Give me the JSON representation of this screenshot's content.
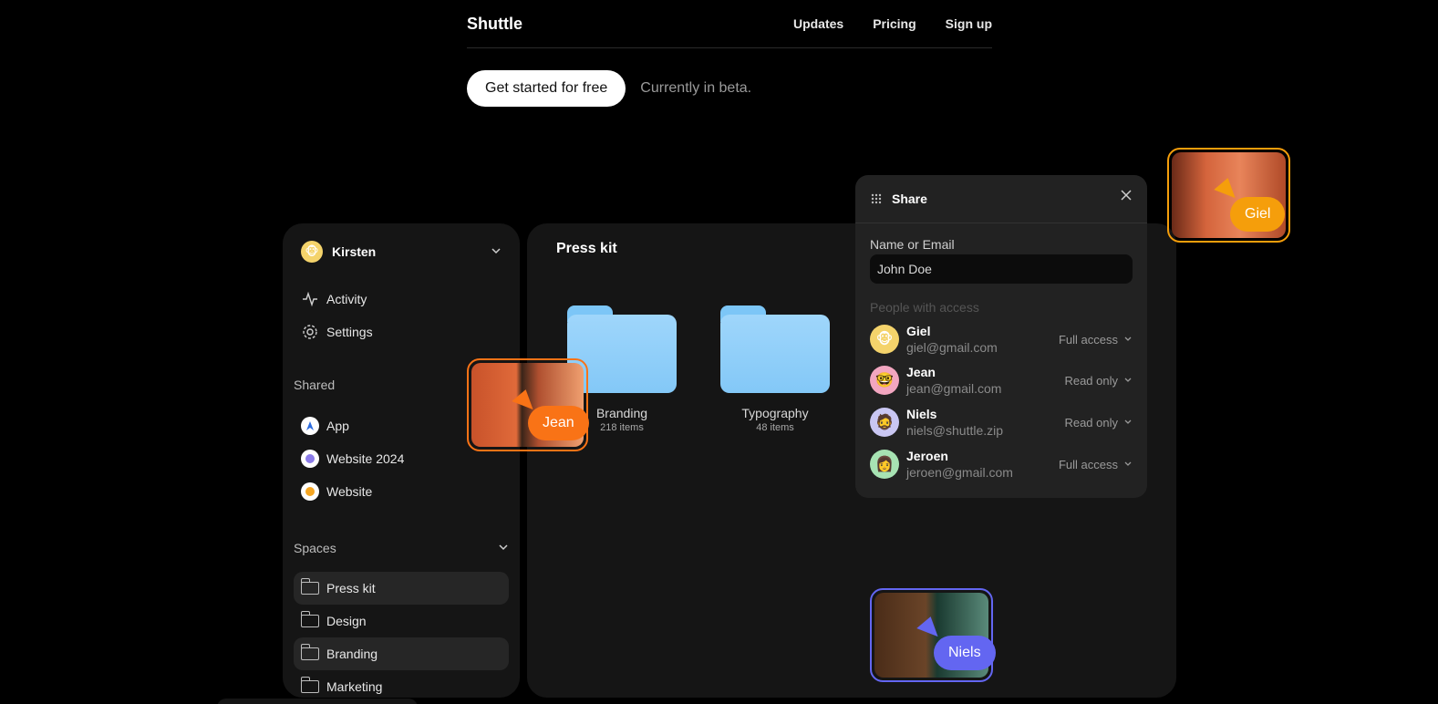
{
  "nav": {
    "brand": "Shuttle",
    "links": [
      "Updates",
      "Pricing",
      "Sign up"
    ]
  },
  "hero": {
    "cta_label": "Get started for free",
    "beta_text": "Currently in beta."
  },
  "sidebar": {
    "user_name": "Kirsten",
    "items": [
      {
        "label": "Activity",
        "icon": "activity-icon"
      },
      {
        "label": "Settings",
        "icon": "gear-icon"
      }
    ],
    "shared_label": "Shared",
    "shared": [
      {
        "label": "App",
        "color": "#2d6cdf"
      },
      {
        "label": "Website 2024",
        "color": "#8b7be8"
      },
      {
        "label": "Website",
        "color": "#f5a623"
      }
    ],
    "spaces_label": "Spaces",
    "spaces": [
      {
        "label": "Press kit",
        "active": true
      },
      {
        "label": "Design",
        "active": false
      },
      {
        "label": "Branding",
        "active": true
      },
      {
        "label": "Marketing",
        "active": false
      }
    ]
  },
  "main": {
    "title": "Press kit",
    "folders": [
      {
        "name": "Branding",
        "count": "218 items"
      },
      {
        "name": "Typography",
        "count": "48 items"
      }
    ]
  },
  "share": {
    "title": "Share",
    "field_label": "Name or Email",
    "field_value": "John Doe",
    "people_label": "People with access",
    "people": [
      {
        "name": "Giel",
        "email": "giel@gmail.com",
        "access": "Full access",
        "avatar_color": "#f4d36b"
      },
      {
        "name": "Jean",
        "email": "jean@gmail.com",
        "access": "Read only",
        "avatar_color": "#f2a6c0"
      },
      {
        "name": "Niels",
        "email": "niels@shuttle.zip",
        "access": "Read only",
        "avatar_color": "#c9c6f2"
      },
      {
        "name": "Jeroen",
        "email": "jeroen@gmail.com",
        "access": "Full access",
        "avatar_color": "#a7e3b3"
      }
    ]
  },
  "cursors": {
    "jean": {
      "label": "Jean",
      "color": "#f97316"
    },
    "giel": {
      "label": "Giel",
      "color": "#f59e0b"
    },
    "niels": {
      "label": "Niels",
      "color": "#6366f1"
    }
  }
}
